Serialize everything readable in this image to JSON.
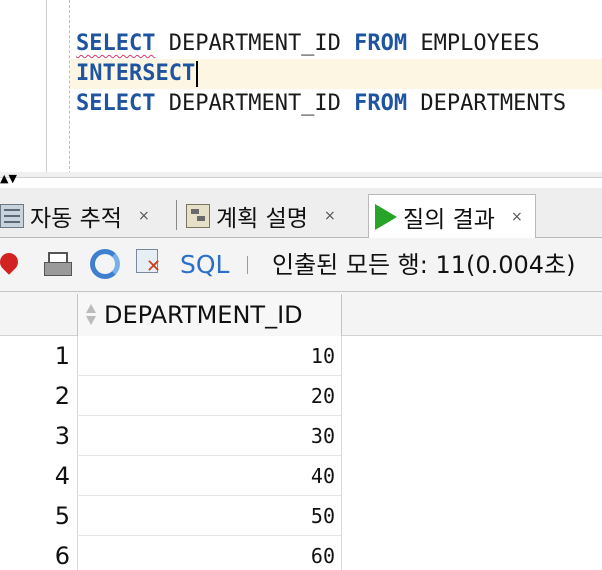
{
  "editor": {
    "line1": {
      "kw1": "SELECT",
      "col": "DEPARTMENT_ID",
      "kw2": "FROM",
      "table": "EMPLOYEES"
    },
    "line2": {
      "kw": "INTERSECT"
    },
    "line3": {
      "kw1": "SELECT",
      "col": "DEPARTMENT_ID",
      "kw2": "FROM",
      "table": "DEPARTMENTS"
    }
  },
  "tabs": [
    {
      "label": "자동 추적",
      "close": "×",
      "icon": "autotrace-icon"
    },
    {
      "label": "계획 설명",
      "close": "×",
      "icon": "explain-plan-icon"
    },
    {
      "label": "질의 결과",
      "close": "×",
      "icon": "run-icon",
      "active": true
    }
  ],
  "toolbar": {
    "sql_label": "SQL",
    "status": "인출된 모든 행: 11(0.004초)",
    "icons": [
      "pin-icon",
      "print-icon",
      "refresh-icon",
      "clear-icon"
    ]
  },
  "grid": {
    "column": "DEPARTMENT_ID",
    "rows": [
      {
        "n": "1",
        "v": "10"
      },
      {
        "n": "2",
        "v": "20"
      },
      {
        "n": "3",
        "v": "30"
      },
      {
        "n": "4",
        "v": "40"
      },
      {
        "n": "5",
        "v": "50"
      },
      {
        "n": "6",
        "v": "60"
      }
    ]
  },
  "colors": {
    "keyword": "#1f55a0",
    "current_line": "#fdf6e3",
    "sql_link": "#2a6fc8",
    "run_icon": "#28a428"
  }
}
